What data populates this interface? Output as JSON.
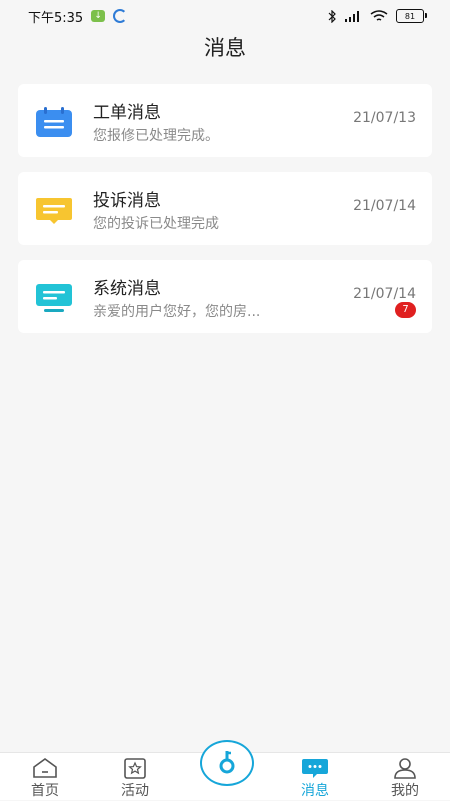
{
  "status": {
    "time": "下午5:35",
    "battery": "81"
  },
  "header": {
    "title": "消息"
  },
  "messages": [
    {
      "title": "工单消息",
      "preview": "您报修已处理完成。",
      "date": "21/07/13",
      "icon": "work-order-icon"
    },
    {
      "title": "投诉消息",
      "preview": "您的投诉已处理完成",
      "date": "21/07/14",
      "icon": "complaint-icon"
    },
    {
      "title": "系统消息",
      "preview": "亲爱的用户您好，您的房...",
      "date": "21/07/14",
      "badge": "7",
      "icon": "system-icon"
    }
  ],
  "nav": {
    "home": "首页",
    "activity": "活动",
    "messages": "消息",
    "mine": "我的"
  },
  "colors": {
    "accent": "#16a6d9",
    "badge": "#e02020",
    "work_order": "#3b8ef0",
    "complaint": "#f7c530",
    "system": "#22c3d6"
  }
}
